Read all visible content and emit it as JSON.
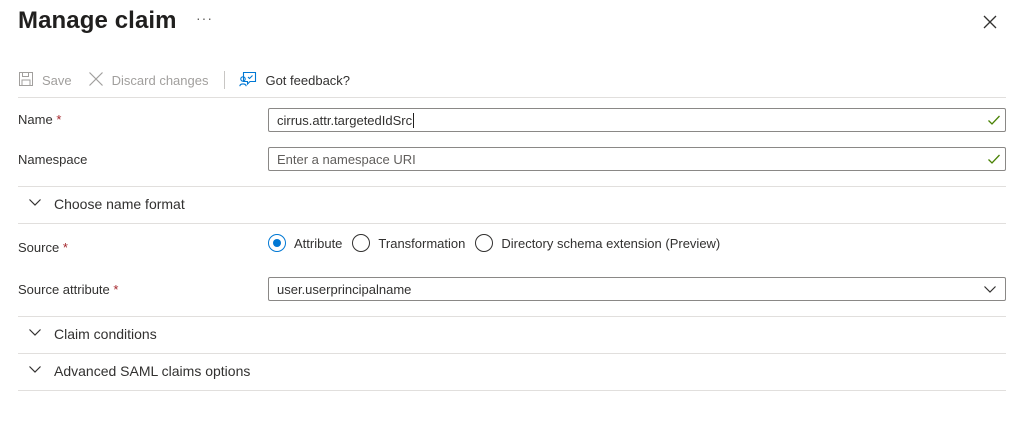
{
  "panel": {
    "title": "Manage claim",
    "more_label": "···"
  },
  "toolbar": {
    "save_label": "Save",
    "discard_label": "Discard changes",
    "feedback_label": "Got feedback?"
  },
  "form": {
    "name": {
      "label": "Name",
      "required_mark": "*",
      "value": "cirrus.attr.targetedIdSrc"
    },
    "namespace": {
      "label": "Namespace",
      "placeholder": "Enter a namespace URI"
    },
    "name_format_section": "Choose name format",
    "source": {
      "label": "Source",
      "required_mark": "*",
      "options": [
        "Attribute",
        "Transformation",
        "Directory schema extension (Preview)"
      ],
      "selected": "Attribute"
    },
    "source_attribute": {
      "label": "Source attribute",
      "required_mark": "*",
      "value": "user.userprincipalname"
    },
    "claim_conditions_section": "Claim conditions",
    "advanced_section": "Advanced SAML claims options"
  },
  "colors": {
    "accent": "#0078d4",
    "required": "#a4262c",
    "valid": "#498205"
  },
  "icons": [
    "more-icon",
    "close-icon",
    "save-icon",
    "discard-icon",
    "feedback-icon",
    "check-icon",
    "chevron-down-icon"
  ]
}
